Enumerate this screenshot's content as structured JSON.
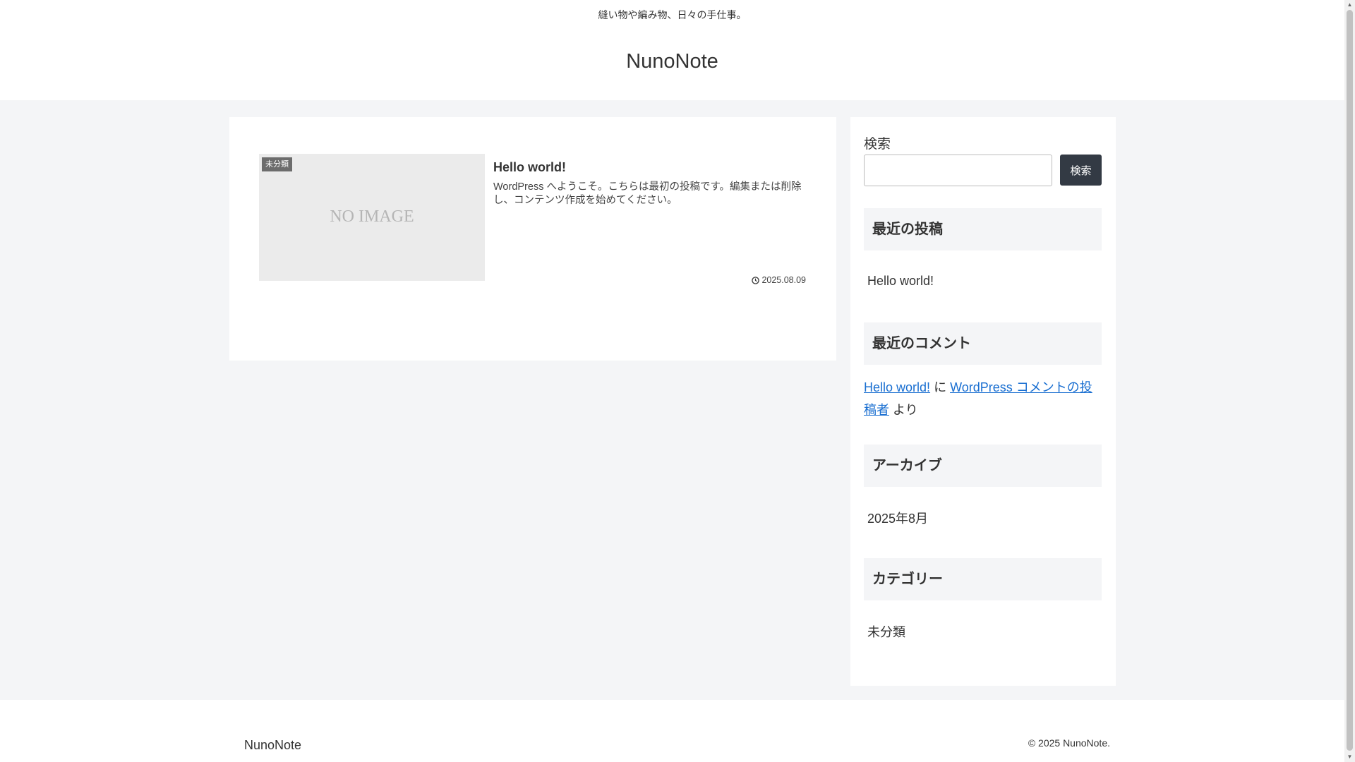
{
  "header": {
    "tagline": "縫い物や編み物、日々の手仕事。",
    "site_title": "NunoNote"
  },
  "main": {
    "post": {
      "category": "未分類",
      "thumbnail_text": "NO IMAGE",
      "title": "Hello world!",
      "snippet": "WordPress へようこそ。こちらは最初の投稿です。編集または削除し、コンテンツ作成を始めてください。",
      "date": "2025.08.09"
    }
  },
  "sidebar": {
    "search": {
      "label": "検索",
      "button_label": "検索",
      "value": "",
      "placeholder": ""
    },
    "recent_posts": {
      "heading": "最近の投稿",
      "items": [
        "Hello world!"
      ]
    },
    "recent_comments": {
      "heading": "最近のコメント",
      "post_link": "Hello world!",
      "connector": "に",
      "author_link": "WordPress コメントの投稿者",
      "suffix": "より"
    },
    "archives": {
      "heading": "アーカイブ",
      "items": [
        "2025年8月"
      ]
    },
    "categories": {
      "heading": "カテゴリー",
      "items": [
        "未分類"
      ]
    }
  },
  "footer": {
    "site_title": "NunoNote",
    "copyright": "© 2025 NunoNote."
  },
  "colors": {
    "page_background": "#f4f5f7",
    "search_button": "#333a44",
    "link": "#1a6fd1",
    "category_badge": "#6c6c6c"
  }
}
